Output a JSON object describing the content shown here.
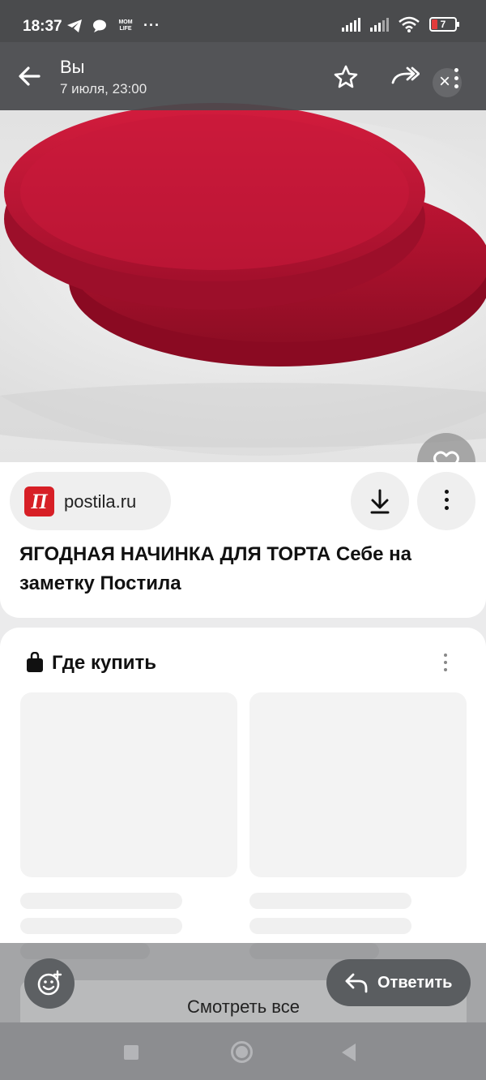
{
  "status_bar": {
    "time": "18:37",
    "notification_icons": [
      "telegram-icon",
      "chat-bubble-icon",
      "mom-life-icon",
      "more-notifications-icon"
    ],
    "app_badge_text": "MOM LIFE",
    "more_text": "···",
    "battery": "7",
    "battery_color": "#e23b3b"
  },
  "header": {
    "sender": "Вы",
    "date": "7 июля, 23:00",
    "close_glyph": "×"
  },
  "pin": {
    "source": "postila.ru",
    "logo_text": "П",
    "logo_color": "#d71f26",
    "title": "ЯГОДНАЯ НАЧИНКА ДЛЯ ТОРТА Себе на заметку Постила"
  },
  "shopping": {
    "title": "Где купить",
    "see_all": "Смотреть все"
  },
  "reply": {
    "label": "Ответить"
  }
}
